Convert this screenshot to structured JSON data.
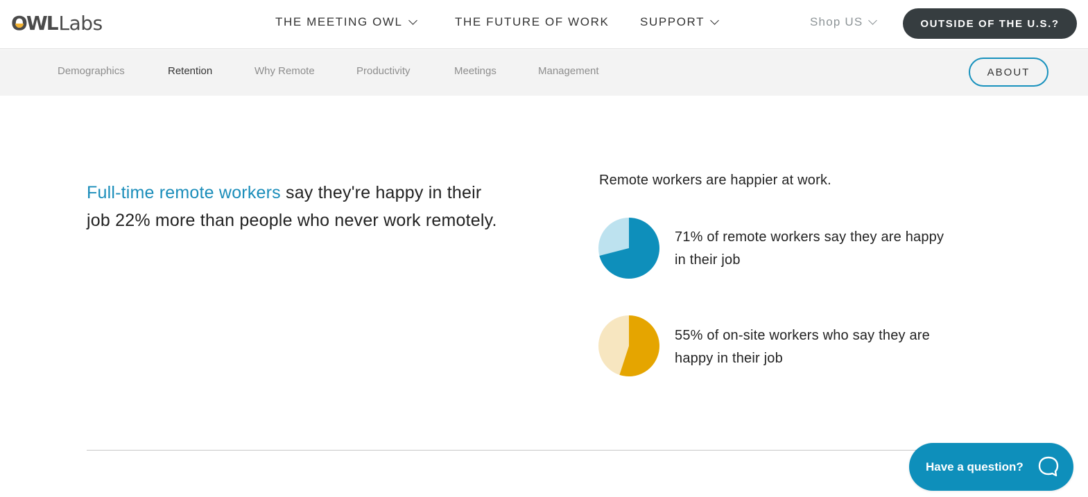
{
  "header": {
    "logo": {
      "bold": "OWL",
      "light": "Labs"
    },
    "nav": [
      {
        "label": "THE MEETING OWL",
        "has_dropdown": true
      },
      {
        "label": "THE FUTURE OF WORK",
        "has_dropdown": false
      },
      {
        "label": "SUPPORT",
        "has_dropdown": true
      }
    ],
    "shop": {
      "label": "Shop US",
      "has_dropdown": true
    },
    "outside_button": "OUTSIDE OF THE U.S.?"
  },
  "subnav": {
    "items": [
      {
        "label": "Demographics",
        "active": false
      },
      {
        "label": "Retention",
        "active": true
      },
      {
        "label": "Why Remote",
        "active": false
      },
      {
        "label": "Productivity",
        "active": false
      },
      {
        "label": "Meetings",
        "active": false
      },
      {
        "label": "Management",
        "active": false
      }
    ],
    "about_button": "ABOUT"
  },
  "main": {
    "lead_highlight": "Full-time remote workers",
    "lead_rest": " say they're happy in their job 22% more than people who never work remotely."
  },
  "colors": {
    "accent": "#1a8dba",
    "remote_primary": "#0e8fbb",
    "remote_secondary": "#bde2ef",
    "onsite_primary": "#e5a500",
    "onsite_secondary": "#f7e6c0",
    "dark_button": "#363d40"
  },
  "chart_data": {
    "type": "pie",
    "title": "Remote workers are happier at work.",
    "charts": [
      {
        "name": "remote",
        "value_percent": 71,
        "remainder_percent": 29,
        "label_value": "71%",
        "label_text": " of remote workers say they are happy in their job"
      },
      {
        "name": "onsite",
        "value_percent": 55,
        "remainder_percent": 45,
        "label_value": "55%",
        "label_text": " of on-site workers who say they are happy in their job"
      }
    ]
  },
  "chat": {
    "label": "Have a question?",
    "icon": "chat-bubble-icon"
  }
}
